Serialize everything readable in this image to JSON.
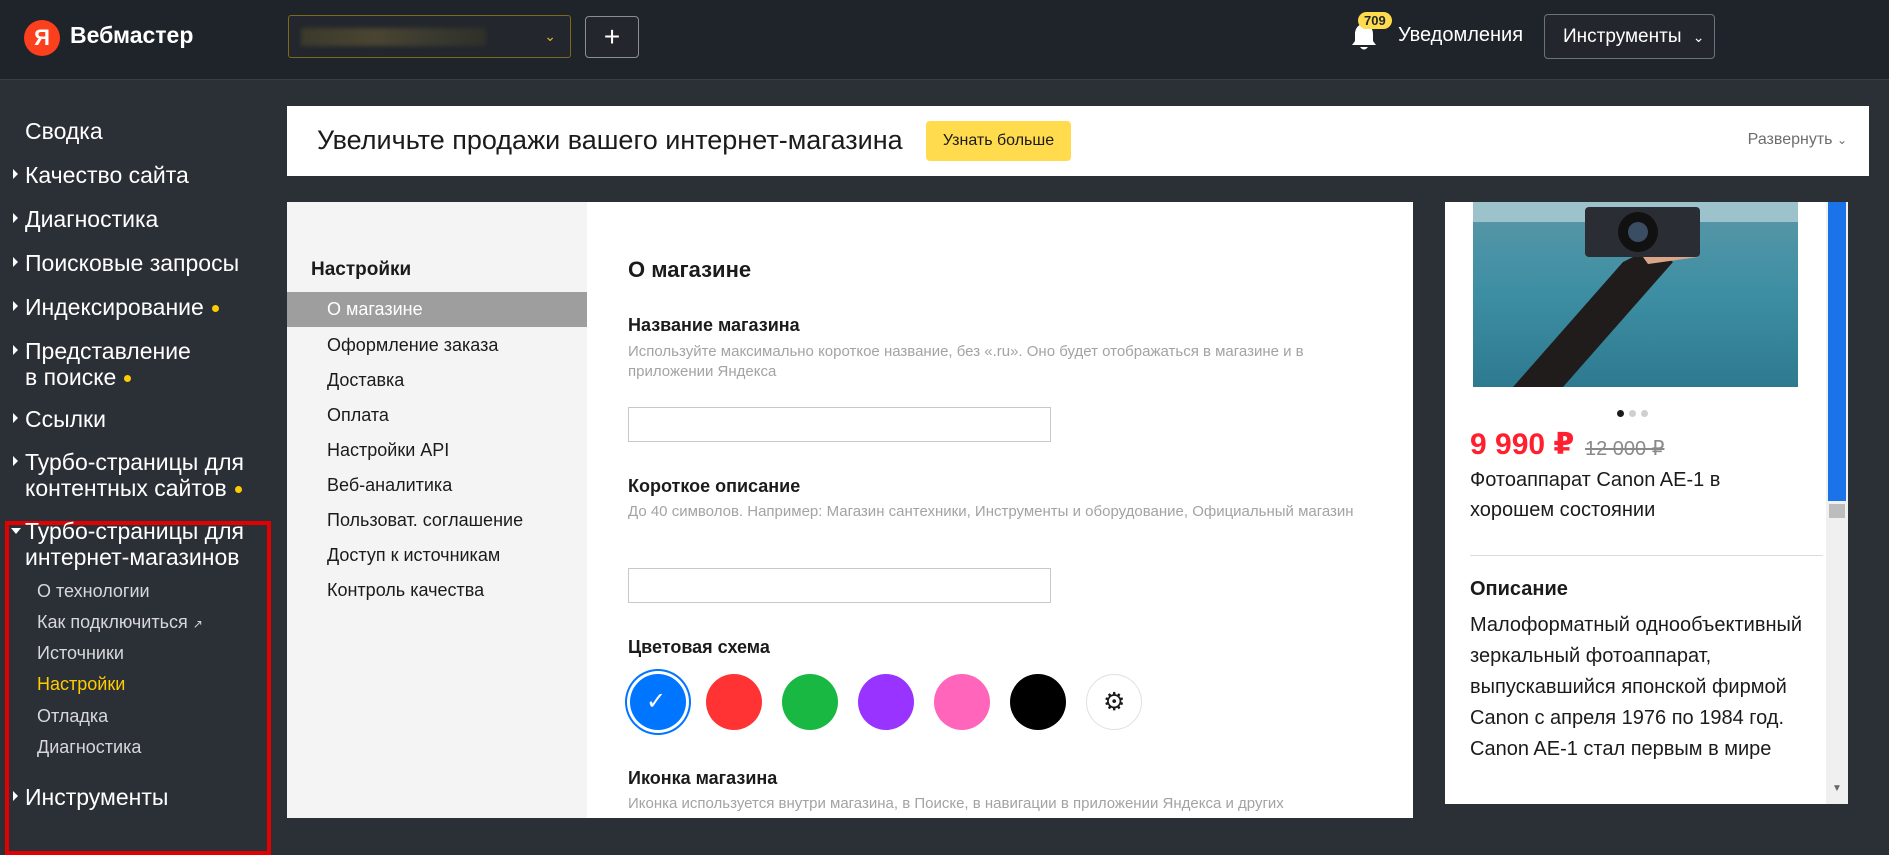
{
  "header": {
    "logo_letter": "Я",
    "brand": "Вебмастер",
    "add_label": "+",
    "notifications_count": "709",
    "notifications_label": "Уведомления",
    "tools_label": "Инструменты",
    "icons": {
      "select_chevron": "chevron-down-icon",
      "bell": "bell-icon",
      "tools_chevron": "chevron-down-icon"
    }
  },
  "sidebar": {
    "items": [
      {
        "label": "Сводка"
      },
      {
        "label": "Качество сайта"
      },
      {
        "label": "Диагностика"
      },
      {
        "label": "Поисковые запросы"
      },
      {
        "label": "Индексирование"
      },
      {
        "label": "Представление",
        "label2": "в поиске"
      },
      {
        "label": "Ссылки"
      },
      {
        "label": "Турбо-страницы для",
        "label2": "контентных сайтов"
      },
      {
        "label": "Турбо-страницы для",
        "label2": "интернет-магазинов"
      },
      {
        "label": "Инструменты"
      }
    ],
    "sub_items": [
      {
        "label": "О технологии"
      },
      {
        "label": "Как подключиться"
      },
      {
        "label": "Источники"
      },
      {
        "label": "Настройки",
        "active": true
      },
      {
        "label": "Отладка"
      },
      {
        "label": "Диагностика"
      }
    ],
    "highlight_color": "#e30000",
    "dot_color": "#ffcc00"
  },
  "promo": {
    "text": "Увеличьте продажи вашего интернет-магазина",
    "button": "Узнать больше",
    "expand": "Развернуть"
  },
  "settings_nav": {
    "title": "Настройки",
    "items": [
      {
        "label": "О магазине",
        "active": true
      },
      {
        "label": "Оформление заказа"
      },
      {
        "label": "Доставка"
      },
      {
        "label": "Оплата"
      },
      {
        "label": "Настройки API"
      },
      {
        "label": "Веб-аналитика"
      },
      {
        "label": "Пользоват. соглашение"
      },
      {
        "label": "Доступ к источникам"
      },
      {
        "label": "Контроль качества"
      }
    ]
  },
  "form": {
    "title": "О магазине",
    "shop_name_label": "Название магазина",
    "shop_name_hint": "Используйте максимально короткое название, без «.ru». Оно будет отображаться в магазине и в приложении Яндекса",
    "shop_name_value": "",
    "short_desc_label": "Короткое описание",
    "short_desc_hint": "До 40 символов. Например: Магазин сантехники, Инструменты и оборудование, Официальный магазин",
    "short_desc_value": "",
    "color_scheme_label": "Цветовая схема",
    "colors": [
      "#0075ff",
      "#ff3333",
      "#18b843",
      "#9933ff",
      "#ff66bb",
      "#000000"
    ],
    "selected_color": "#0075ff",
    "icon_label": "Иконка магазина",
    "icon_hint": "Иконка используется внутри магазина, в Поиске, в навигации в приложении Яндекса и других"
  },
  "preview": {
    "price": "9 990 ₽",
    "old_price": "12 000 ₽",
    "product_name": "Фотоаппарат Canon AE-1 в хорошем состоянии",
    "description_title": "Описание",
    "description": "Малоформатный однообъективный зеркальный фотоаппарат, выпускавшийся японской фирмой Canon с апреля 1976 по 1984 год.",
    "description2": "Canon AE-1 стал первым в мире"
  }
}
